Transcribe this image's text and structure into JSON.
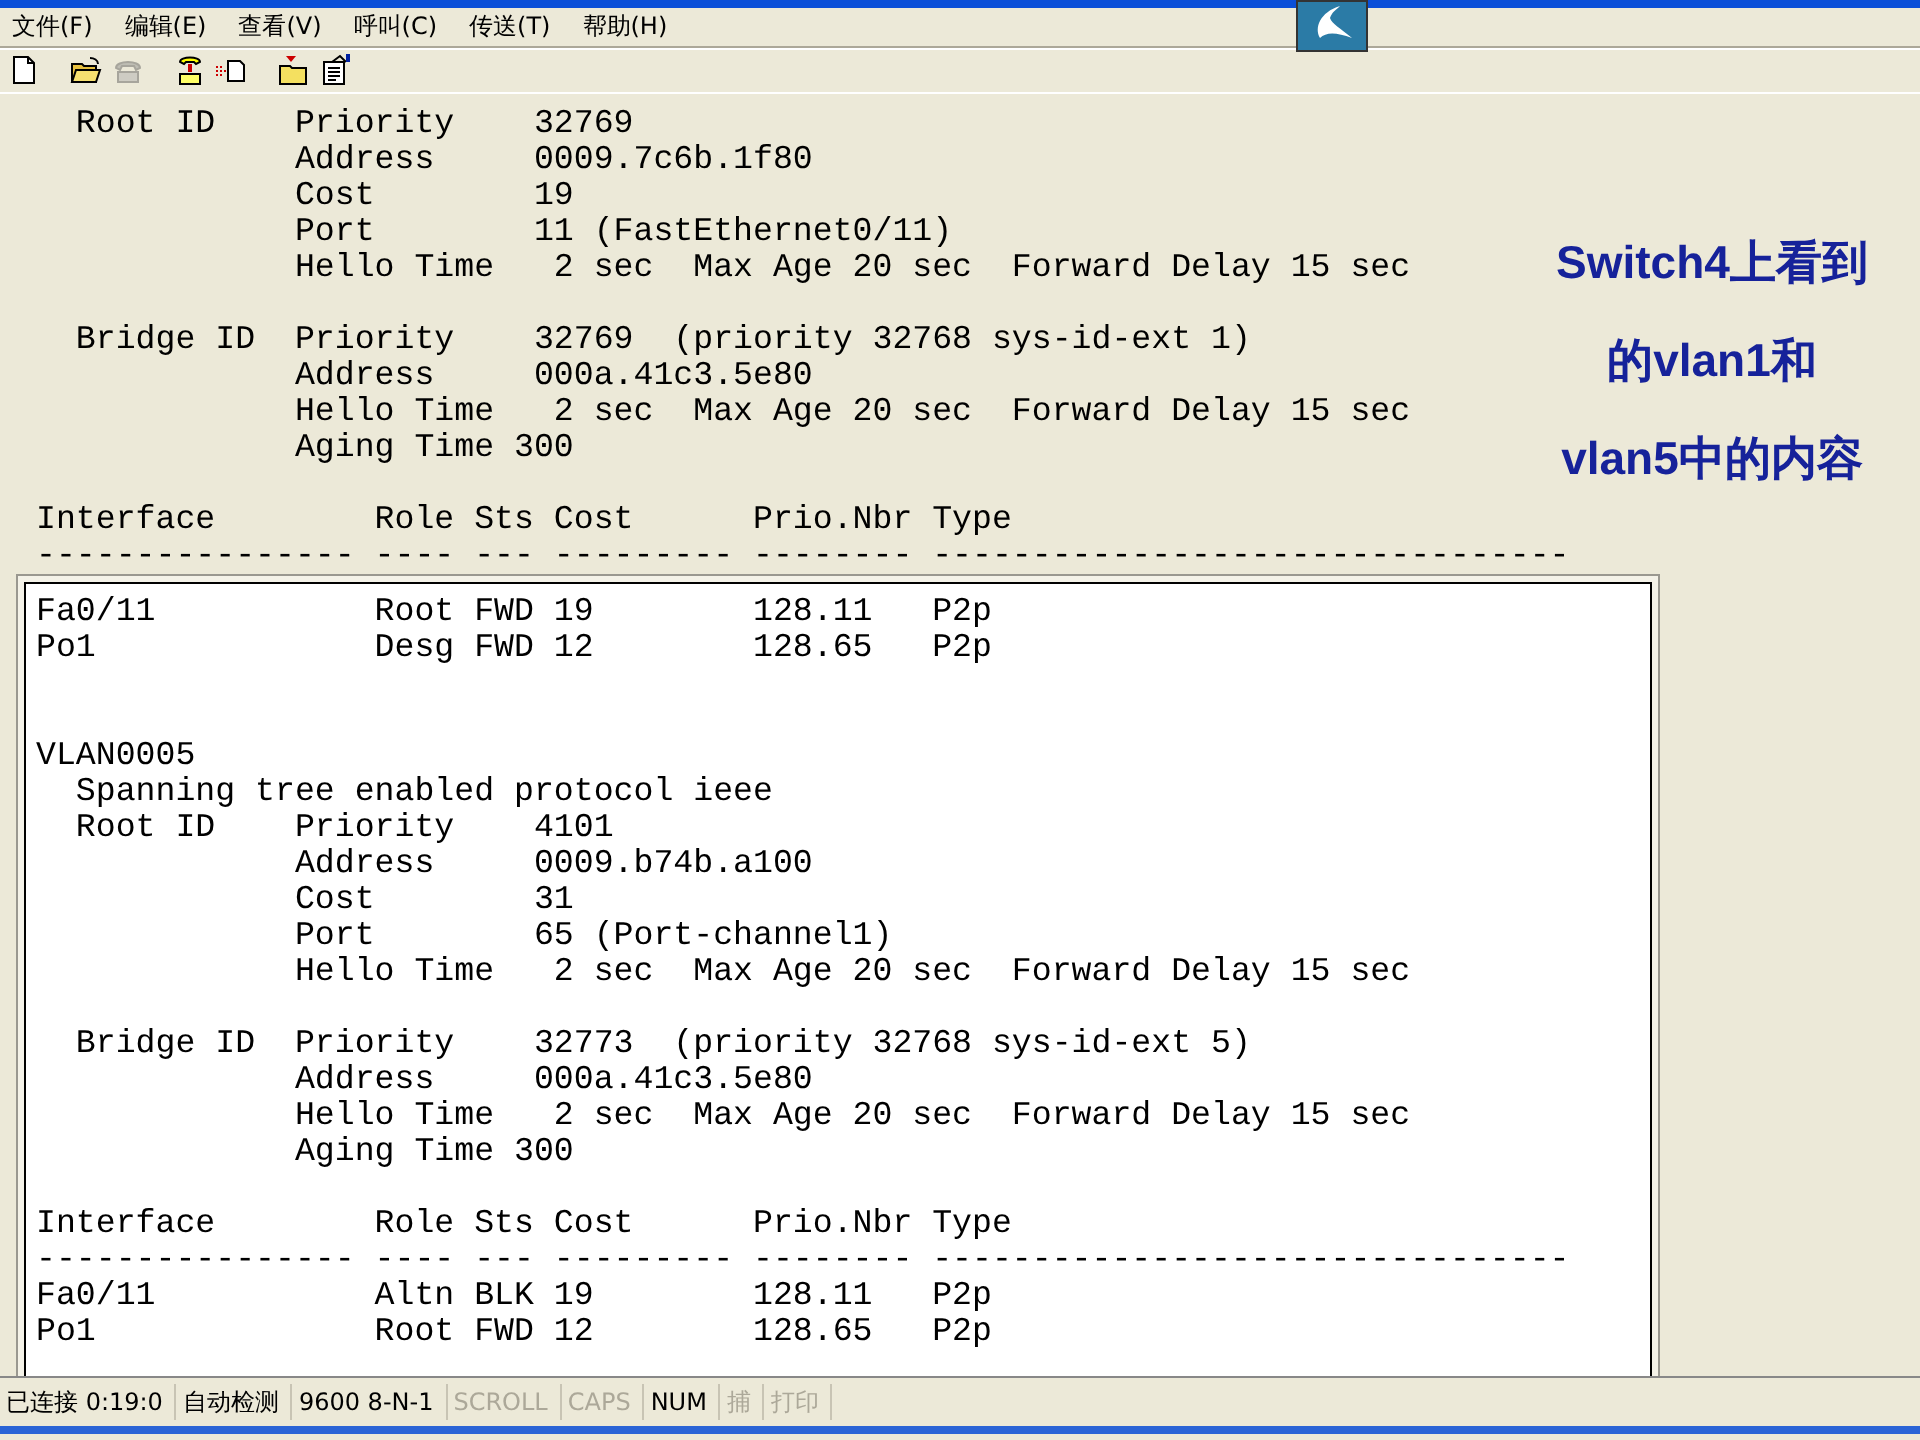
{
  "menu": [
    "文件(F)",
    "编辑(E)",
    "查看(V)",
    "呼叫(C)",
    "传送(T)",
    "帮助(H)"
  ],
  "toolbar": [
    {
      "kind": "new",
      "disabled": false
    },
    {
      "kind": "open",
      "disabled": false
    },
    {
      "kind": "phone",
      "disabled": true
    },
    {
      "kind": "hangup",
      "disabled": false
    },
    {
      "kind": "send",
      "disabled": false
    },
    {
      "kind": "receive",
      "disabled": false
    },
    {
      "kind": "properties",
      "disabled": false
    }
  ],
  "terminal": {
    "upper_blocks": [
      {
        "lines": [
          "  Root ID    Priority    32769",
          "             Address     0009.7c6b.1f80",
          "             Cost        19",
          "             Port        11 (FastEthernet0/11)",
          "             Hello Time   2 sec  Max Age 20 sec  Forward Delay 15 sec"
        ]
      },
      {
        "lines": [
          "  Bridge ID  Priority    32769  (priority 32768 sys-id-ext 1)",
          "             Address     000a.41c3.5e80",
          "             Hello Time   2 sec  Max Age 20 sec  Forward Delay 15 sec",
          "             Aging Time 300"
        ]
      },
      {
        "lines": [
          "Interface        Role Sts Cost      Prio.Nbr Type",
          "---------------- ---- --- --------- -------- --------------------------------"
        ]
      }
    ],
    "lower_blocks": [
      {
        "lines": [
          "Fa0/11           Root FWD 19        128.11   P2p",
          "Po1              Desg FWD 12        128.65   P2p"
        ]
      },
      {
        "lines": [
          "VLAN0005",
          "  Spanning tree enabled protocol ieee",
          "  Root ID    Priority    4101",
          "             Address     0009.b74b.a100",
          "             Cost        31",
          "             Port        65 (Port-channel1)",
          "             Hello Time   2 sec  Max Age 20 sec  Forward Delay 15 sec"
        ]
      },
      {
        "lines": [
          "  Bridge ID  Priority    32773  (priority 32768 sys-id-ext 5)",
          "             Address     000a.41c3.5e80",
          "             Hello Time   2 sec  Max Age 20 sec  Forward Delay 15 sec",
          "             Aging Time 300"
        ]
      },
      {
        "lines": [
          "Interface        Role Sts Cost      Prio.Nbr Type",
          "---------------- ---- --- --------- -------- --------------------------------",
          "Fa0/11           Altn BLK 19        128.11   P2p",
          "Po1              Root FWD 12        128.65   P2p"
        ]
      }
    ]
  },
  "note": [
    "Switch4上看到",
    "的vlan1和",
    "vlan5中的内容"
  ],
  "status_bar": [
    {
      "text": "已连接 0:19:0",
      "disabled": false
    },
    {
      "text": "自动检测",
      "disabled": false
    },
    {
      "text": "9600 8-N-1",
      "disabled": false
    },
    {
      "text": "SCROLL",
      "disabled": true
    },
    {
      "text": "CAPS",
      "disabled": true
    },
    {
      "text": "NUM",
      "disabled": false
    },
    {
      "text": "捕",
      "disabled": true
    },
    {
      "text": "打印",
      "disabled": true
    }
  ]
}
